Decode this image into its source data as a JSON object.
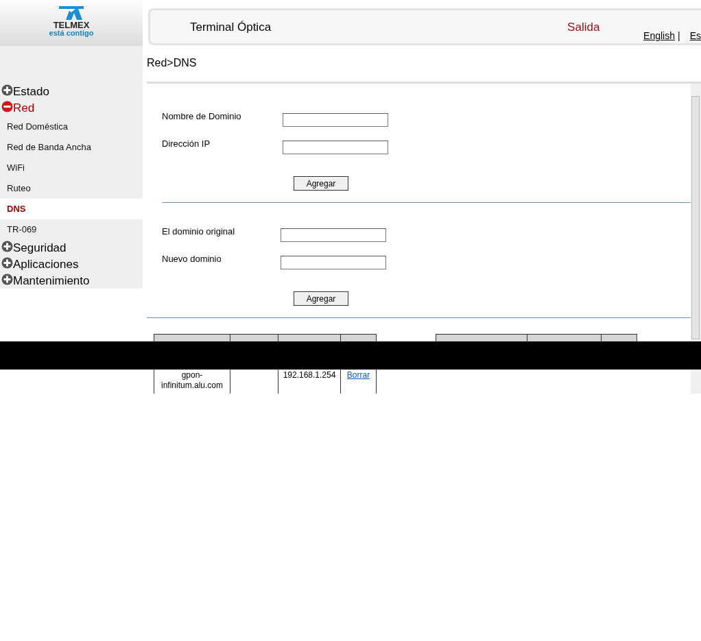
{
  "logo": {
    "brand": "TELMEX",
    "tagline": "está contigo"
  },
  "header": {
    "title": "Terminal Óptica",
    "logout": "Salida",
    "languages": [
      "English",
      "Es"
    ],
    "separator": "|"
  },
  "breadcrumb": "Red>DNS",
  "sidebar": [
    {
      "label": "Estado",
      "expanded": false
    },
    {
      "label": "Red",
      "expanded": true,
      "children": [
        {
          "label": "Red Doméstica",
          "selected": false
        },
        {
          "label": "Red de Banda Ancha",
          "selected": false
        },
        {
          "label": "WiFi",
          "selected": false
        },
        {
          "label": "Ruteo",
          "selected": false
        },
        {
          "label": "DNS",
          "selected": true
        },
        {
          "label": "TR-069",
          "selected": false
        }
      ]
    },
    {
      "label": "Seguridad",
      "expanded": false
    },
    {
      "label": "Aplicaciones",
      "expanded": false
    },
    {
      "label": "Mantenimiento",
      "expanded": false
    }
  ],
  "forms": [
    {
      "fields": [
        "Nombre de Dominio",
        "Dirección IP"
      ],
      "button": "Agregar"
    },
    {
      "fields": [
        "El dominio original",
        "Nuevo dominio"
      ],
      "button": "Agregar"
    }
  ],
  "tables": [
    {
      "kind": "hosts",
      "rows": [
        [
          {
            "kind": "text",
            "text": "gpon- infinitum.alu.com"
          },
          {
            "kind": "empty"
          },
          {
            "kind": "text",
            "text": "192.168.1.254"
          },
          {
            "kind": "link",
            "text": "Borrar"
          }
        ]
      ]
    },
    {
      "kind": "redirects"
    }
  ]
}
